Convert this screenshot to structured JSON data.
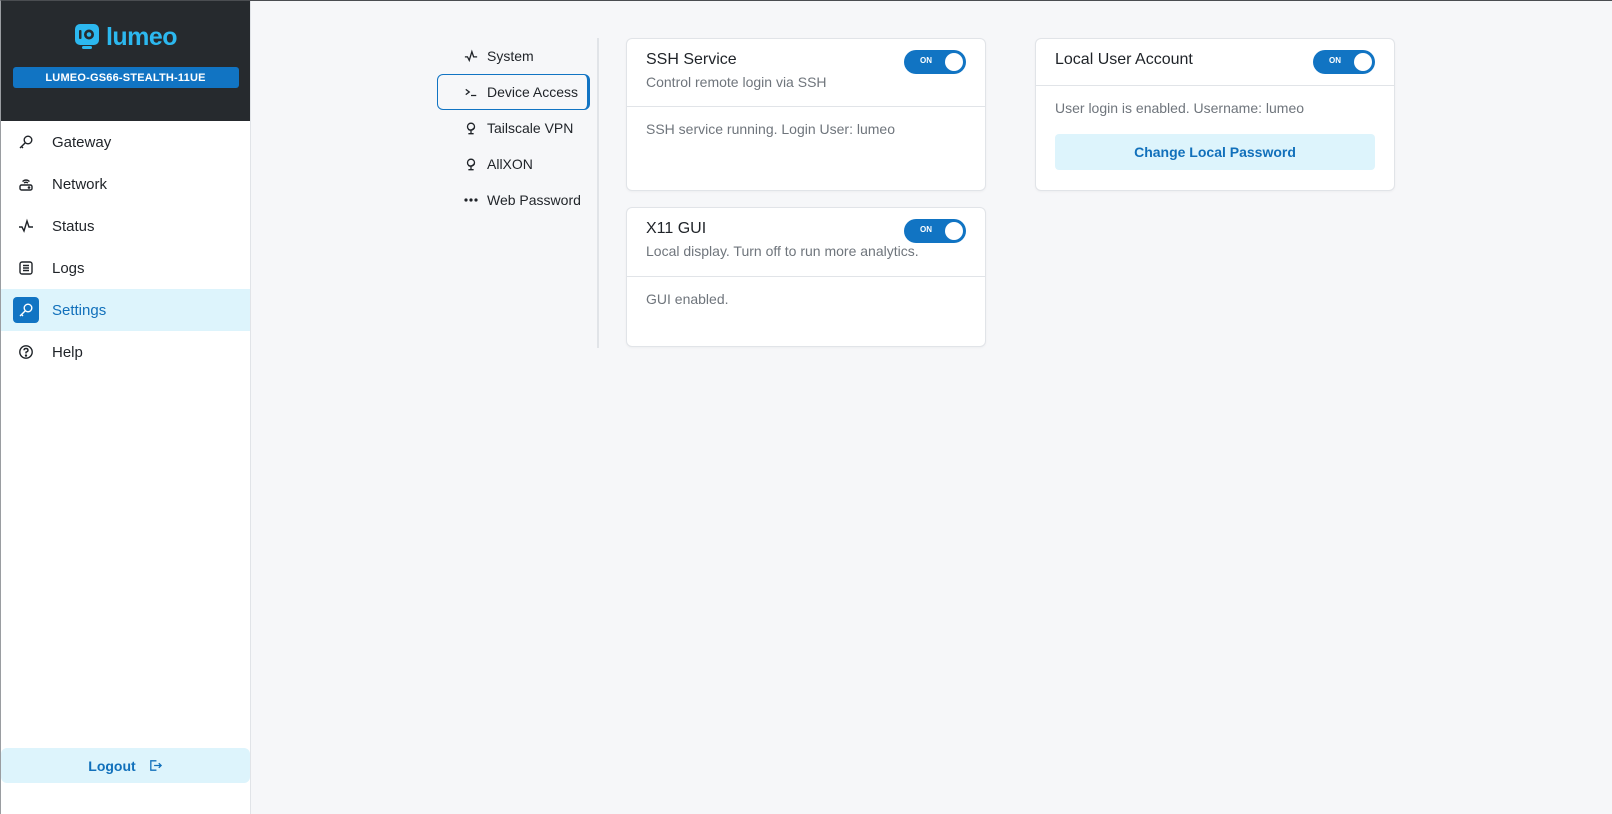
{
  "sidebar": {
    "logo_text": "lumeo",
    "device_name": "LUMEO-GS66-STEALTH-11UE",
    "items": [
      {
        "label": "Gateway",
        "icon": "key-icon",
        "active": false
      },
      {
        "label": "Network",
        "icon": "router-icon",
        "active": false
      },
      {
        "label": "Status",
        "icon": "pulse-icon",
        "active": false
      },
      {
        "label": "Logs",
        "icon": "list-icon",
        "active": false
      },
      {
        "label": "Settings",
        "icon": "key-icon",
        "active": true
      },
      {
        "label": "Help",
        "icon": "help-icon",
        "active": false
      }
    ],
    "logout_label": "Logout"
  },
  "settings_nav": {
    "items": [
      {
        "label": "System",
        "icon": "pulse-icon",
        "active": false
      },
      {
        "label": "Device Access",
        "icon": "terminal-icon",
        "active": true
      },
      {
        "label": "Tailscale VPN",
        "icon": "globe-icon",
        "active": false
      },
      {
        "label": "AllXON",
        "icon": "globe-icon",
        "active": false
      },
      {
        "label": "Web Password",
        "icon": "dots-icon",
        "active": false
      }
    ]
  },
  "cards": {
    "ssh": {
      "title": "SSH Service",
      "subtitle": "Control remote login via SSH",
      "toggle_label": "ON",
      "toggle_on": true,
      "status": "SSH service running. Login User: lumeo"
    },
    "x11": {
      "title": "X11 GUI",
      "subtitle": "Local display. Turn off to run more analytics.",
      "toggle_label": "ON",
      "toggle_on": true,
      "status": "GUI enabled."
    },
    "local_user": {
      "title": "Local User Account",
      "toggle_label": "ON",
      "toggle_on": true,
      "status": "User login is enabled. Username: lumeo",
      "button_label": "Change Local Password"
    }
  },
  "colors": {
    "accent": "#1174c3",
    "brand_cyan": "#2cb8ef",
    "active_bg": "#ddf4fc",
    "header_bg": "#262a2e"
  }
}
